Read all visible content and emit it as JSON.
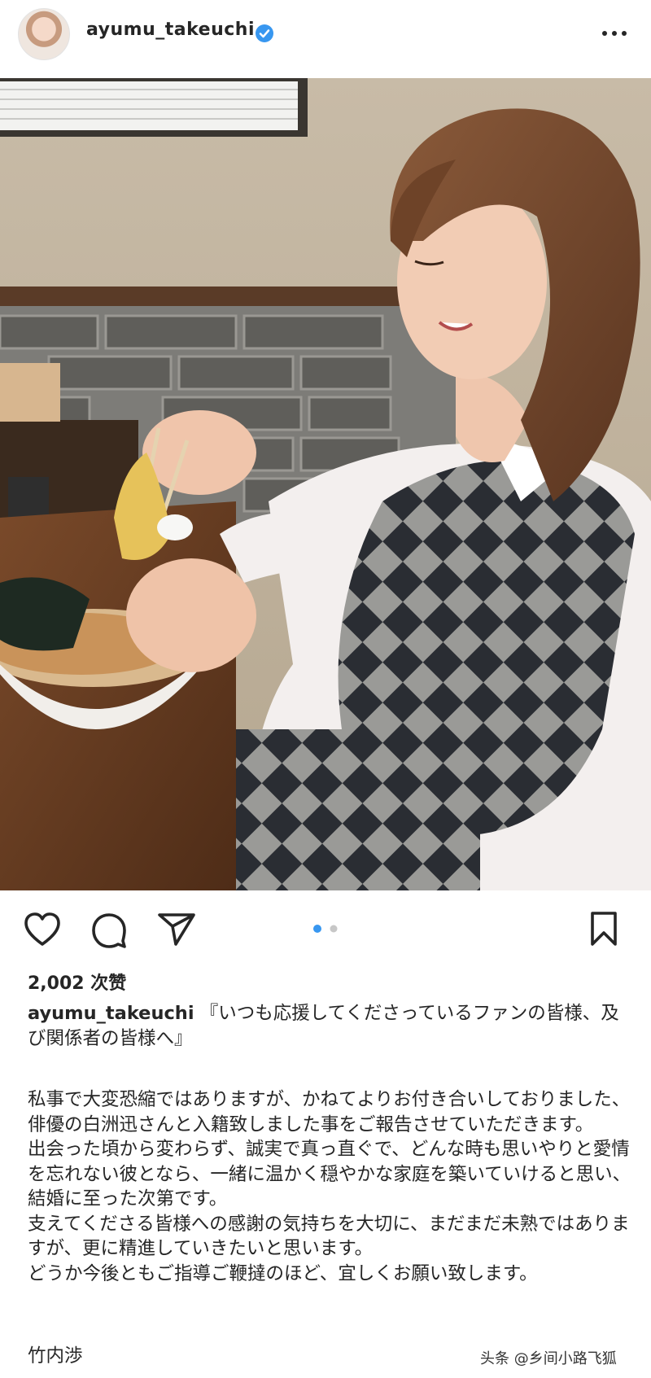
{
  "post": {
    "username": "ayumu_takeuchi",
    "likes": "2,002 次赞",
    "caption_user": "ayumu_takeuchi",
    "caption_head": " 『いつも応援してくださっているファンの皆様、及び関係者の皆様へ』",
    "body": [
      "私事で大変恐縮ではありますが、かねてよりお付き合いしておりました、俳優の白洲迅さんと入籍致しました事をご報告させていただきます。",
      "出会った頃から変わらず、誠実で真っ直ぐで、どんな時も思いやりと愛情を忘れない彼となら、一緒に温かく穏やかな家庭を築いていけると思い、結婚に至った次第です。",
      "支えてくださる皆様への感謝の気持ちを大切に、まだまだ未熟ではありますが、更に精進していきたいと思います。",
      "どうか今後ともご指導ご鞭撻のほど、宜しくお願い致します。"
    ],
    "signature": "竹内渉",
    "carousel": {
      "count": 2,
      "active": 1
    }
  },
  "watermark": "头条 @乡间小路飞狐",
  "icons": [
    "heart-icon",
    "comment-icon",
    "share-icon",
    "bookmark-icon",
    "more-icon",
    "verified-icon"
  ],
  "colors": {
    "verified": "#3897f0",
    "carousel_active": "#3897f0",
    "carousel_inactive": "#c7c7c7"
  }
}
